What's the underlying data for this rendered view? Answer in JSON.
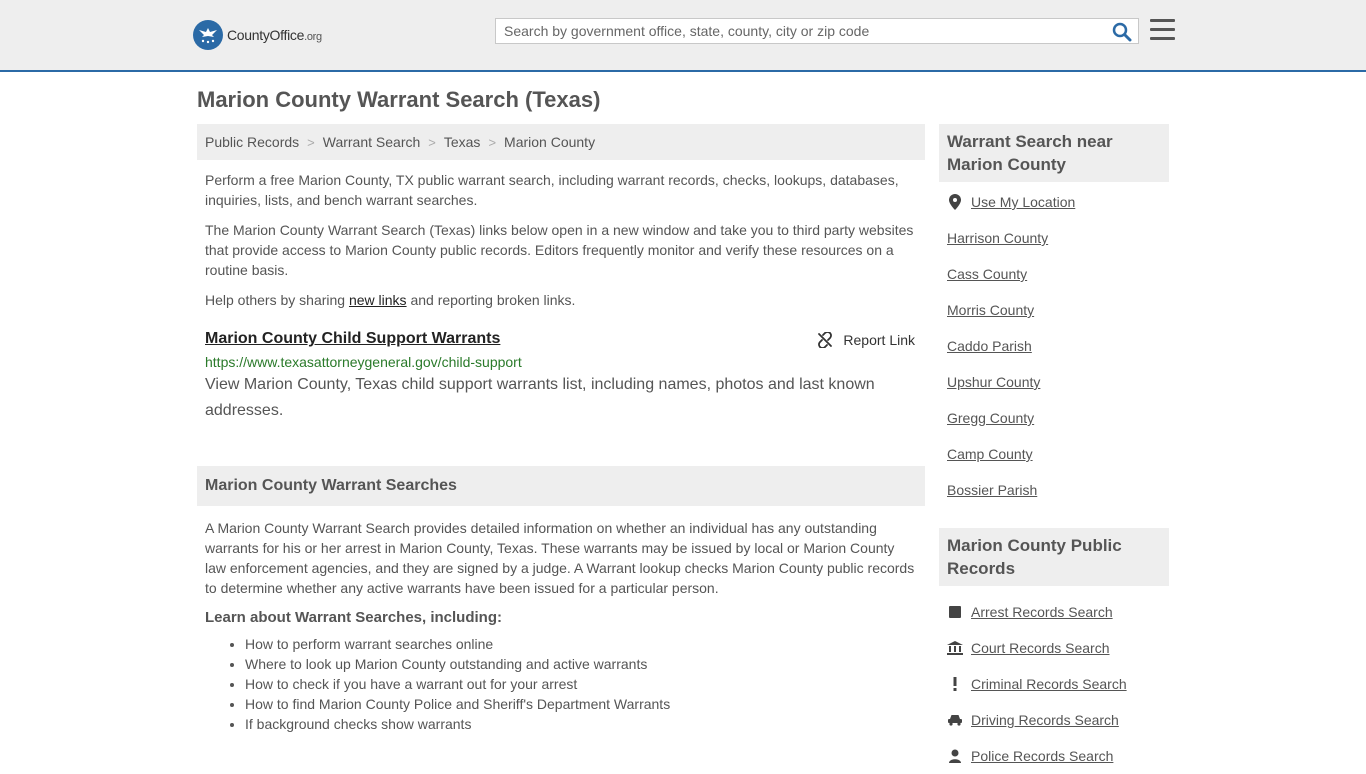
{
  "header": {
    "logo_main": "CountyOffice",
    "logo_suffix": ".org",
    "search_placeholder": "Search by government office, state, county, city or zip code"
  },
  "page": {
    "title": "Marion County Warrant Search (Texas)"
  },
  "breadcrumb": [
    {
      "label": "Public Records"
    },
    {
      "label": "Warrant Search"
    },
    {
      "label": "Texas"
    },
    {
      "label": "Marion County"
    }
  ],
  "intro": {
    "p1": "Perform a free Marion County, TX public warrant search, including warrant records, checks, lookups, databases, inquiries, lists, and bench warrant searches.",
    "p2": "The Marion County Warrant Search (Texas) links below open in a new window and take you to third party websites that provide access to Marion County public records. Editors frequently monitor and verify these resources on a routine basis.",
    "p3_before": "Help others by sharing ",
    "p3_link": "new links",
    "p3_after": " and reporting broken links."
  },
  "result": {
    "title": "Marion County Child Support Warrants",
    "report_label": "Report Link",
    "url": "https://www.texasattorneygeneral.gov/child-support",
    "description": "View Marion County, Texas child support warrants list, including names, photos and last known addresses."
  },
  "section": {
    "heading": "Marion County Warrant Searches",
    "body": "A Marion County Warrant Search provides detailed information on whether an individual has any outstanding warrants for his or her arrest in Marion County, Texas. These warrants may be issued by local or Marion County law enforcement agencies, and they are signed by a judge. A Warrant lookup checks Marion County public records to determine whether any active warrants have been issued for a particular person.",
    "learn_heading": "Learn about Warrant Searches, including:",
    "items": [
      "How to perform warrant searches online",
      "Where to look up Marion County outstanding and active warrants",
      "How to check if you have a warrant out for your arrest",
      "How to find Marion County Police and Sheriff's Department Warrants",
      "If background checks show warrants"
    ]
  },
  "sidebar": {
    "nearby_heading": "Warrant Search near Marion County",
    "use_location": "Use My Location",
    "nearby": [
      "Harrison County",
      "Cass County",
      "Morris County",
      "Caddo Parish",
      "Upshur County",
      "Gregg County",
      "Camp County",
      "Bossier Parish"
    ],
    "records_heading": "Marion County Public Records",
    "records": [
      {
        "label": "Arrest Records Search",
        "icon": "square-icon"
      },
      {
        "label": "Court Records Search",
        "icon": "courthouse-icon"
      },
      {
        "label": "Criminal Records Search",
        "icon": "exclamation-icon"
      },
      {
        "label": "Driving Records Search",
        "icon": "car-icon"
      },
      {
        "label": "Police Records Search",
        "icon": "police-icon"
      }
    ]
  },
  "colors": {
    "accent": "#2b6aa6",
    "url_green": "#2a7a2a",
    "panel_bg": "#eeeeee"
  }
}
